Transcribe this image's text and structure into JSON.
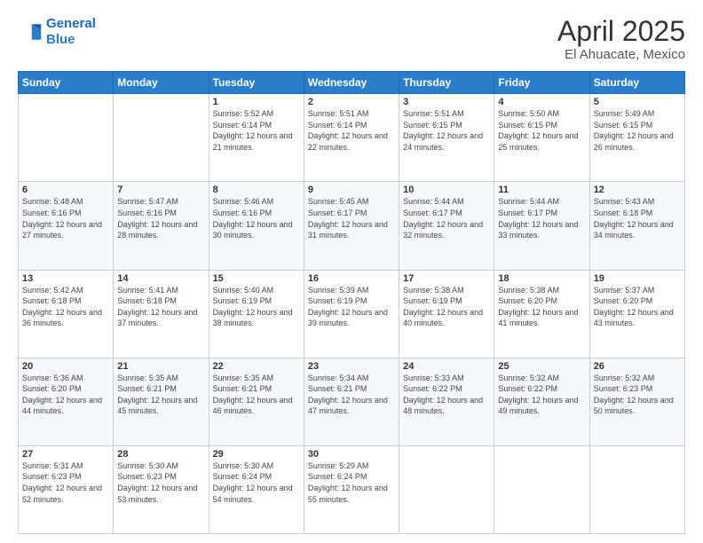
{
  "header": {
    "logo_line1": "General",
    "logo_line2": "Blue",
    "title": "April 2025",
    "subtitle": "El Ahuacate, Mexico"
  },
  "weekdays": [
    "Sunday",
    "Monday",
    "Tuesday",
    "Wednesday",
    "Thursday",
    "Friday",
    "Saturday"
  ],
  "weeks": [
    [
      {
        "day": "",
        "info": ""
      },
      {
        "day": "",
        "info": ""
      },
      {
        "day": "1",
        "info": "Sunrise: 5:52 AM\nSunset: 6:14 PM\nDaylight: 12 hours and 21 minutes."
      },
      {
        "day": "2",
        "info": "Sunrise: 5:51 AM\nSunset: 6:14 PM\nDaylight: 12 hours and 22 minutes."
      },
      {
        "day": "3",
        "info": "Sunrise: 5:51 AM\nSunset: 6:15 PM\nDaylight: 12 hours and 24 minutes."
      },
      {
        "day": "4",
        "info": "Sunrise: 5:50 AM\nSunset: 6:15 PM\nDaylight: 12 hours and 25 minutes."
      },
      {
        "day": "5",
        "info": "Sunrise: 5:49 AM\nSunset: 6:15 PM\nDaylight: 12 hours and 26 minutes."
      }
    ],
    [
      {
        "day": "6",
        "info": "Sunrise: 5:48 AM\nSunset: 6:16 PM\nDaylight: 12 hours and 27 minutes."
      },
      {
        "day": "7",
        "info": "Sunrise: 5:47 AM\nSunset: 6:16 PM\nDaylight: 12 hours and 28 minutes."
      },
      {
        "day": "8",
        "info": "Sunrise: 5:46 AM\nSunset: 6:16 PM\nDaylight: 12 hours and 30 minutes."
      },
      {
        "day": "9",
        "info": "Sunrise: 5:45 AM\nSunset: 6:17 PM\nDaylight: 12 hours and 31 minutes."
      },
      {
        "day": "10",
        "info": "Sunrise: 5:44 AM\nSunset: 6:17 PM\nDaylight: 12 hours and 32 minutes."
      },
      {
        "day": "11",
        "info": "Sunrise: 5:44 AM\nSunset: 6:17 PM\nDaylight: 12 hours and 33 minutes."
      },
      {
        "day": "12",
        "info": "Sunrise: 5:43 AM\nSunset: 6:18 PM\nDaylight: 12 hours and 34 minutes."
      }
    ],
    [
      {
        "day": "13",
        "info": "Sunrise: 5:42 AM\nSunset: 6:18 PM\nDaylight: 12 hours and 36 minutes."
      },
      {
        "day": "14",
        "info": "Sunrise: 5:41 AM\nSunset: 6:18 PM\nDaylight: 12 hours and 37 minutes."
      },
      {
        "day": "15",
        "info": "Sunrise: 5:40 AM\nSunset: 6:19 PM\nDaylight: 12 hours and 38 minutes."
      },
      {
        "day": "16",
        "info": "Sunrise: 5:39 AM\nSunset: 6:19 PM\nDaylight: 12 hours and 39 minutes."
      },
      {
        "day": "17",
        "info": "Sunrise: 5:38 AM\nSunset: 6:19 PM\nDaylight: 12 hours and 40 minutes."
      },
      {
        "day": "18",
        "info": "Sunrise: 5:38 AM\nSunset: 6:20 PM\nDaylight: 12 hours and 41 minutes."
      },
      {
        "day": "19",
        "info": "Sunrise: 5:37 AM\nSunset: 6:20 PM\nDaylight: 12 hours and 43 minutes."
      }
    ],
    [
      {
        "day": "20",
        "info": "Sunrise: 5:36 AM\nSunset: 6:20 PM\nDaylight: 12 hours and 44 minutes."
      },
      {
        "day": "21",
        "info": "Sunrise: 5:35 AM\nSunset: 6:21 PM\nDaylight: 12 hours and 45 minutes."
      },
      {
        "day": "22",
        "info": "Sunrise: 5:35 AM\nSunset: 6:21 PM\nDaylight: 12 hours and 46 minutes."
      },
      {
        "day": "23",
        "info": "Sunrise: 5:34 AM\nSunset: 6:21 PM\nDaylight: 12 hours and 47 minutes."
      },
      {
        "day": "24",
        "info": "Sunrise: 5:33 AM\nSunset: 6:22 PM\nDaylight: 12 hours and 48 minutes."
      },
      {
        "day": "25",
        "info": "Sunrise: 5:32 AM\nSunset: 6:22 PM\nDaylight: 12 hours and 49 minutes."
      },
      {
        "day": "26",
        "info": "Sunrise: 5:32 AM\nSunset: 6:23 PM\nDaylight: 12 hours and 50 minutes."
      }
    ],
    [
      {
        "day": "27",
        "info": "Sunrise: 5:31 AM\nSunset: 6:23 PM\nDaylight: 12 hours and 52 minutes."
      },
      {
        "day": "28",
        "info": "Sunrise: 5:30 AM\nSunset: 6:23 PM\nDaylight: 12 hours and 53 minutes."
      },
      {
        "day": "29",
        "info": "Sunrise: 5:30 AM\nSunset: 6:24 PM\nDaylight: 12 hours and 54 minutes."
      },
      {
        "day": "30",
        "info": "Sunrise: 5:29 AM\nSunset: 6:24 PM\nDaylight: 12 hours and 55 minutes."
      },
      {
        "day": "",
        "info": ""
      },
      {
        "day": "",
        "info": ""
      },
      {
        "day": "",
        "info": ""
      }
    ]
  ]
}
